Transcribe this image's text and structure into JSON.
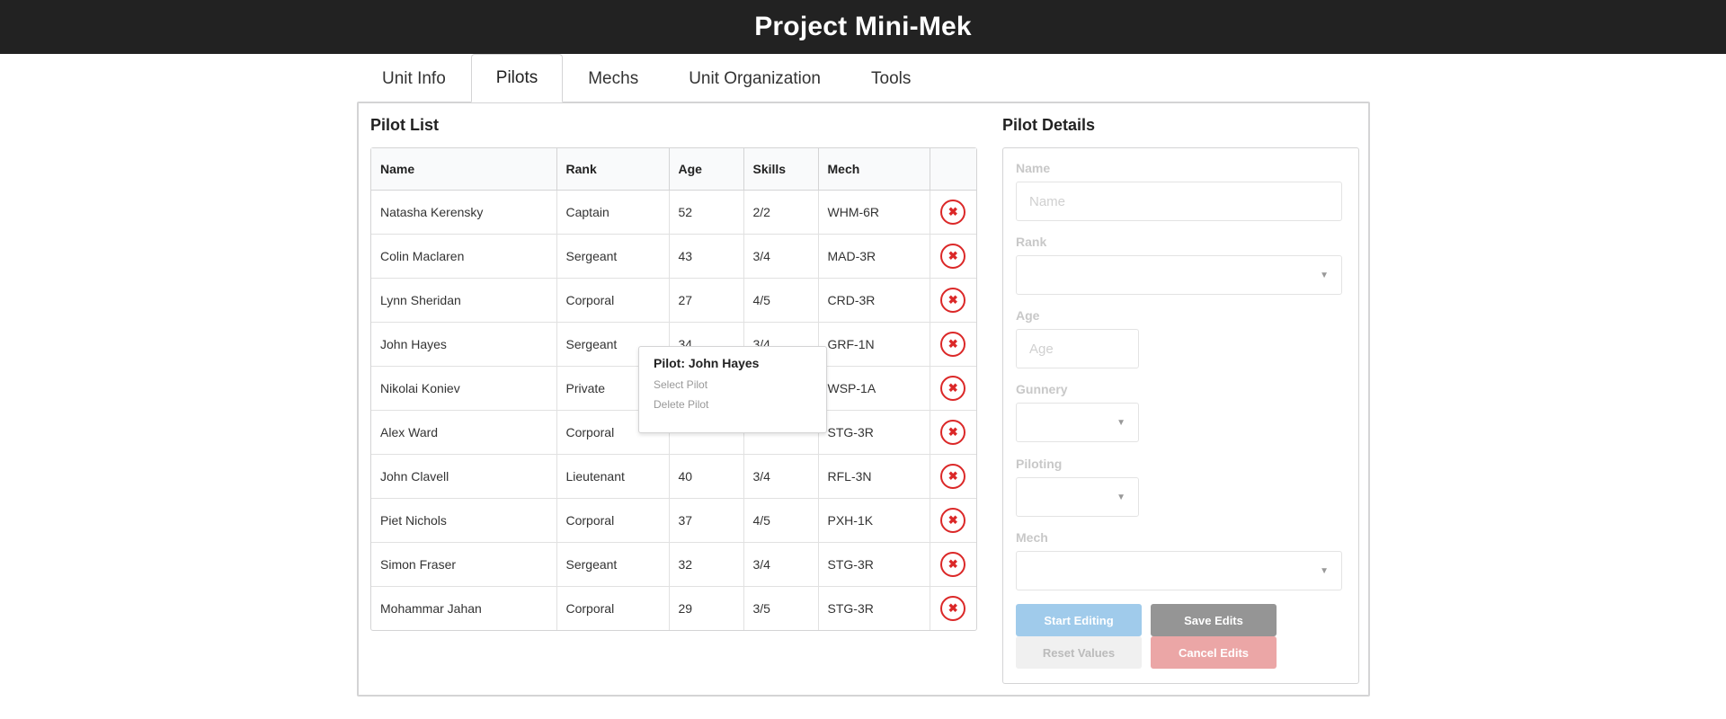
{
  "app": {
    "title": "Project Mini-Mek"
  },
  "tabs": [
    {
      "label": "Unit Info"
    },
    {
      "label": "Pilots",
      "active": true
    },
    {
      "label": "Mechs"
    },
    {
      "label": "Unit Organization"
    },
    {
      "label": "Tools"
    }
  ],
  "pilot_list": {
    "title": "Pilot List",
    "columns": [
      "Name",
      "Rank",
      "Age",
      "Skills",
      "Mech"
    ],
    "rows": [
      [
        "Natasha Kerensky",
        "Captain",
        "52",
        "2/2",
        "WHM-6R"
      ],
      [
        "Colin Maclaren",
        "Sergeant",
        "43",
        "3/4",
        "MAD-3R"
      ],
      [
        "Lynn Sheridan",
        "Corporal",
        "27",
        "4/5",
        "CRD-3R"
      ],
      [
        "John Hayes",
        "Sergeant",
        "34",
        "3/4",
        "GRF-1N"
      ],
      [
        "Nikolai Koniev",
        "Private",
        "",
        "",
        "WSP-1A"
      ],
      [
        "Alex Ward",
        "Corporal",
        "",
        "",
        "STG-3R"
      ],
      [
        "John Clavell",
        "Lieutenant",
        "40",
        "3/4",
        "RFL-3N"
      ],
      [
        "Piet Nichols",
        "Corporal",
        "37",
        "4/5",
        "PXH-1K"
      ],
      [
        "Simon Fraser",
        "Sergeant",
        "32",
        "3/4",
        "STG-3R"
      ],
      [
        "Mohammar Jahan",
        "Corporal",
        "29",
        "3/5",
        "STG-3R"
      ]
    ],
    "delete_glyph": "✖"
  },
  "context_menu": {
    "title": "Pilot: John Hayes",
    "items": [
      "Select Pilot",
      "Delete Pilot"
    ]
  },
  "pilot_details": {
    "title": "Pilot Details",
    "name_label": "Name",
    "name_placeholder": "Name",
    "rank_label": "Rank",
    "age_label": "Age",
    "age_placeholder": "Age",
    "gunnery_label": "Gunnery",
    "piloting_label": "Piloting",
    "mech_label": "Mech",
    "buttons": {
      "start_editing": "Start Editing",
      "save_edits": "Save Edits",
      "reset_values": "Reset Values",
      "cancel_edits": "Cancel Edits"
    }
  },
  "colors": {
    "topbar": "#222222",
    "delete_red": "#db2828",
    "start_blue": "#a0cbeb",
    "save_grey": "#959595",
    "reset_light": "#f0f0f0",
    "cancel_pink": "#eba6a6"
  }
}
